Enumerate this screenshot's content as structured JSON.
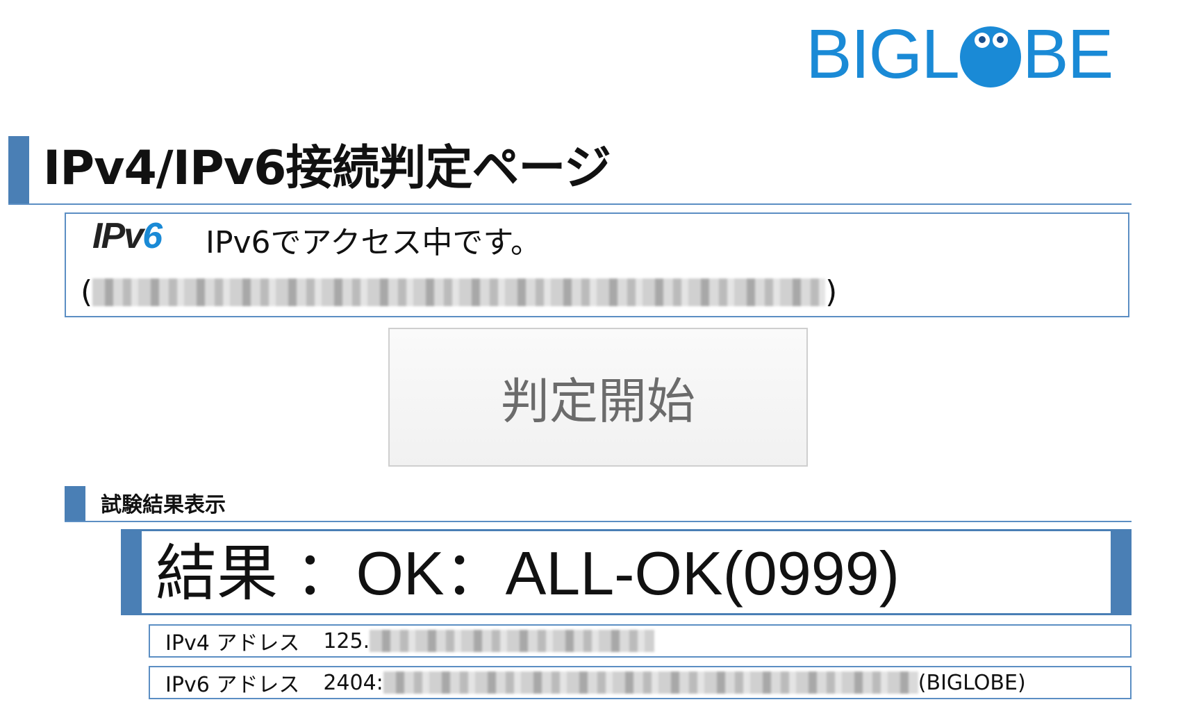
{
  "logo": {
    "text_left": "BIGL",
    "text_right": "BE",
    "brand_color": "#1a8ad6"
  },
  "page": {
    "title": "IPv4/IPv6接続判定ページ",
    "accent_color": "#4a7fb5"
  },
  "status": {
    "badge_left": "IPv",
    "badge_right": "6",
    "message": "IPv6でアクセス中です。",
    "address_open": "(",
    "address_close": ")"
  },
  "start_button": {
    "label": "判定開始"
  },
  "results": {
    "section_title": "試験結果表示",
    "result_line": "結果 ：OK：ALL-OK(0999)",
    "ipv4": {
      "label": "IPv4 アドレス",
      "prefix": "125.",
      "suffix": ""
    },
    "ipv6": {
      "label": "IPv6 アドレス",
      "prefix": "2404:",
      "suffix": "(BIGLOBE)"
    }
  }
}
